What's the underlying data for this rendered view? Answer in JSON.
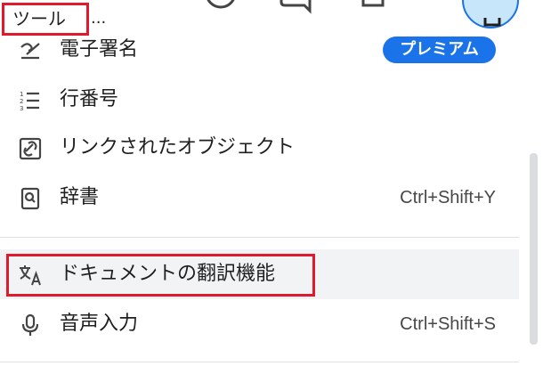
{
  "menu_bar": {
    "active_menu": "ツール",
    "overflow": "..."
  },
  "tools_menu": {
    "items": [
      {
        "label": "電子署名",
        "badge": "プレミアム",
        "icon": "signature-icon"
      },
      {
        "label": "行番号",
        "icon": "line-numbers-icon"
      },
      {
        "label": "リンクされたオブジェクト",
        "icon": "linked-object-icon"
      },
      {
        "label": "辞書",
        "shortcut": "Ctrl+Shift+Y",
        "icon": "dictionary-icon"
      },
      {
        "label": "ドキュメントの翻訳機能",
        "icon": "translate-icon"
      },
      {
        "label": "音声入力",
        "shortcut": "Ctrl+Shift+S",
        "icon": "microphone-icon"
      }
    ]
  },
  "colors": {
    "accent": "#1a73e8",
    "highlight_border": "#e0192d",
    "hover": "#f1f3f4"
  }
}
